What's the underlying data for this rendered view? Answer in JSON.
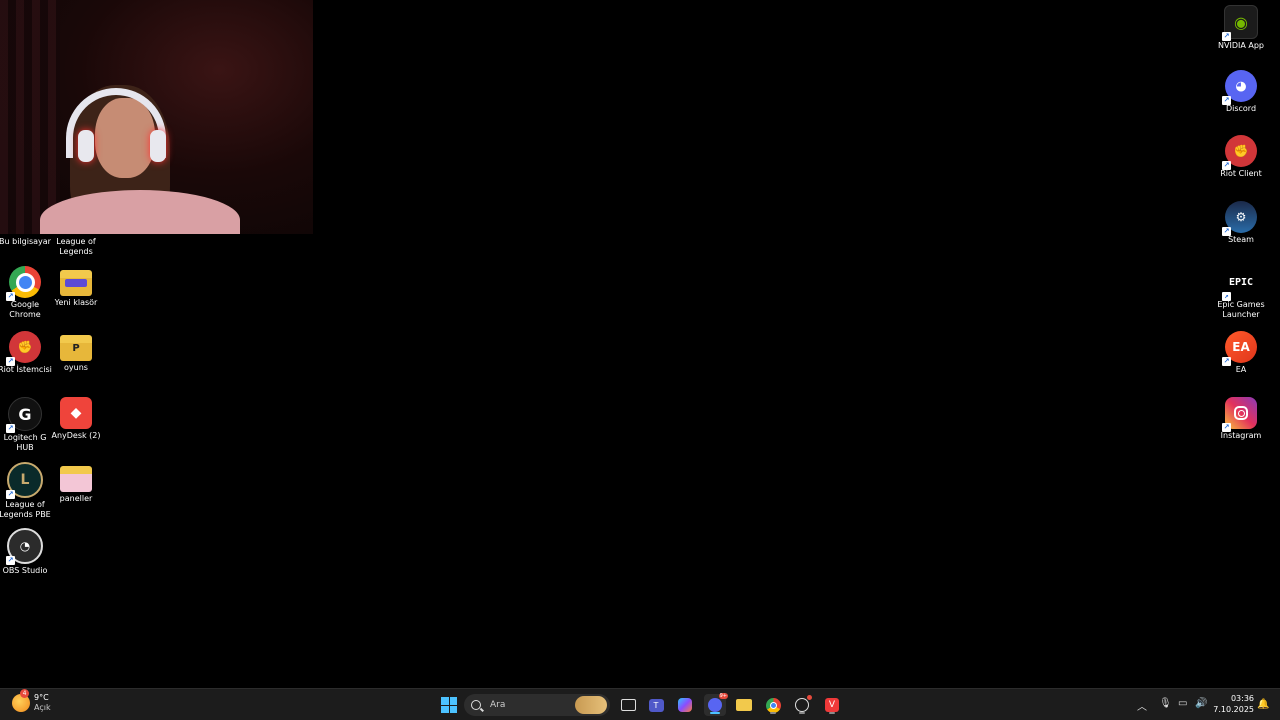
{
  "desktop": {
    "left_icons": [
      {
        "name": "this-pc",
        "label": "Bu bilgisayar",
        "icon": "pc-icon"
      },
      {
        "name": "league-of-legends",
        "label": "League of Legends",
        "icon": "lol-icon"
      },
      {
        "name": "google-chrome",
        "label": "Google Chrome",
        "icon": "chrome-icon"
      },
      {
        "name": "new-folder",
        "label": "Yeni klasör",
        "icon": "folder-icon"
      },
      {
        "name": "riot-client-tr",
        "label": "Riot İstemcisi",
        "icon": "riot-icon"
      },
      {
        "name": "oyuns-folder",
        "label": "oyuns",
        "icon": "folder-icon"
      },
      {
        "name": "logitech-g-hub",
        "label": "Logitech G HUB",
        "icon": "logitech-icon"
      },
      {
        "name": "anydesk",
        "label": "AnyDesk (2)",
        "icon": "anydesk-icon"
      },
      {
        "name": "lol-pbe",
        "label": "League of Legends PBE",
        "icon": "lol-pbe-icon"
      },
      {
        "name": "paneller-folder",
        "label": "paneller",
        "icon": "folder-icon"
      },
      {
        "name": "obs-studio",
        "label": "OBS Studio",
        "icon": "obs-icon"
      }
    ],
    "right_icons": [
      {
        "name": "nvidia-app",
        "label": "NVIDIA App",
        "icon": "nvidia-icon"
      },
      {
        "name": "discord",
        "label": "Discord",
        "icon": "discord-icon"
      },
      {
        "name": "riot-client",
        "label": "Riot Client",
        "icon": "riot-icon"
      },
      {
        "name": "steam",
        "label": "Steam",
        "icon": "steam-icon"
      },
      {
        "name": "epic-games",
        "label": "Epic Games Launcher",
        "icon": "epic-icon"
      },
      {
        "name": "ea",
        "label": "EA",
        "icon": "ea-icon"
      },
      {
        "name": "instagram",
        "label": "Instagram",
        "icon": "instagram-icon"
      }
    ]
  },
  "taskbar": {
    "weather": {
      "temp": "9°C",
      "condition": "Açık",
      "badge": "4"
    },
    "search_placeholder": "Ara",
    "discord_badge": "9+",
    "clock": {
      "time": "03:36",
      "date": "7.10.2025"
    }
  },
  "colors": {
    "accent": "#4cc2ff",
    "taskbar": "#1c1c1c"
  }
}
